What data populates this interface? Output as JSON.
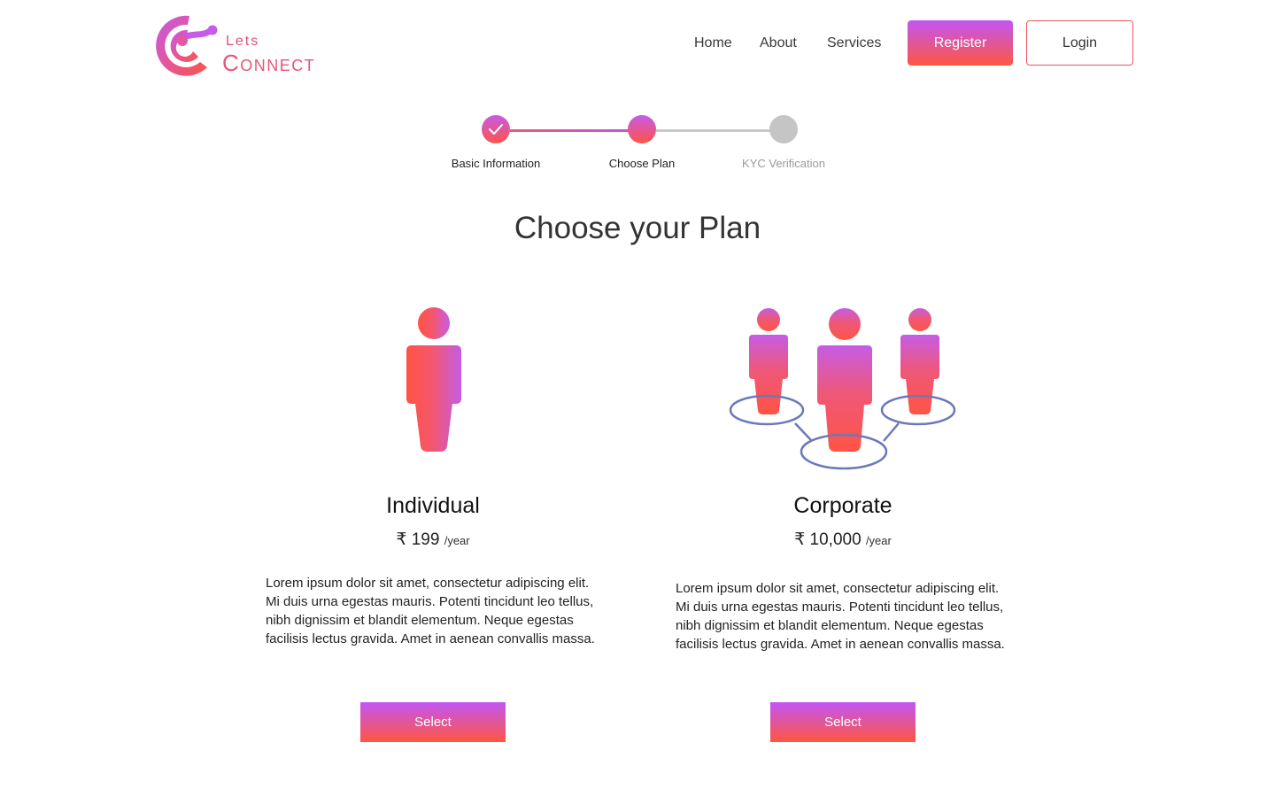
{
  "brand": {
    "lets": "Lets",
    "connect": "Connect"
  },
  "nav": {
    "home": "Home",
    "about": "About",
    "services": "Services",
    "register": "Register",
    "login": "Login"
  },
  "stepper": {
    "steps": [
      {
        "label": "Basic Information",
        "state": "completed"
      },
      {
        "label": "Choose Plan",
        "state": "active"
      },
      {
        "label": "KYC Verification",
        "state": "pending"
      }
    ]
  },
  "page": {
    "title": "Choose your Plan"
  },
  "plans": [
    {
      "name": "Individual",
      "currency": "₹",
      "amount": "199",
      "period": "/year",
      "description": "Lorem ipsum dolor sit amet, consectetur adipiscing elit. Mi duis urna egestas mauris. Potenti tincidunt leo tellus, nibh dignissim et blandit elementum. Neque egestas facilisis lectus gravida. Amet in aenean convallis massa.",
      "select_label": "Select"
    },
    {
      "name": "Corporate",
      "currency": "₹",
      "amount": "10,000",
      "period": "/year",
      "description": "Lorem ipsum dolor sit amet, consectetur adipiscing elit. Mi duis urna egestas mauris. Potenti tincidunt leo tellus, nibh dignissim et blandit elementum. Neque egestas facilisis lectus gravida. Amet in aenean convallis massa.",
      "select_label": "Select"
    }
  ],
  "colors": {
    "gradient_top": "#c156f5",
    "gradient_bottom": "#ff5640",
    "login_border": "#ea5560",
    "inactive": "#c5c5c5",
    "network_ring": "#6c78b8"
  },
  "icons": {
    "logo": "lets-connect-logo",
    "check": "check-icon",
    "individual": "single-person-icon",
    "corporate": "group-network-icon"
  }
}
